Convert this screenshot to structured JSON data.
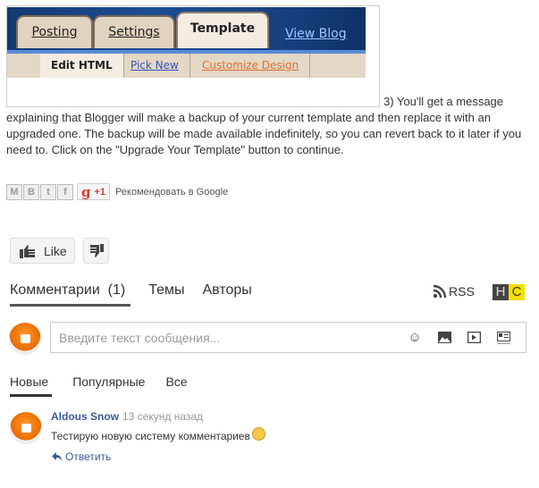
{
  "screenshot": {
    "tabs": [
      {
        "label": "Posting",
        "active": false
      },
      {
        "label": "Settings",
        "active": false
      },
      {
        "label": "Template",
        "active": true
      }
    ],
    "view_blog_link": "View Blog",
    "subtabs": [
      {
        "label": "Edit HTML",
        "style": "active"
      },
      {
        "label": "Pick New",
        "style": "blue"
      },
      {
        "label": "Customize Design",
        "style": "orange"
      }
    ]
  },
  "article": {
    "paragraph_first": "3) You'll get a message",
    "paragraph_rest": "explaining that Blogger will make a backup of your current template and then replace it with an upgraded one. The backup will be made available indefinitely, so you can revert back to it later if you need to. Click on the \"Upgrade Your Template\" button to continue."
  },
  "share": {
    "buttons": [
      "email-icon",
      "blogger-icon",
      "twitter-icon",
      "facebook-icon"
    ],
    "gplus_label": "+1",
    "recommend_text": "Рекомендовать в Google"
  },
  "reactions": {
    "like_label": "Like"
  },
  "comments": {
    "tabs": [
      {
        "label": "Комментарии  (1)",
        "active": true
      },
      {
        "label": "Темы",
        "active": false
      },
      {
        "label": "Авторы",
        "active": false
      }
    ],
    "rss_label": "RSS",
    "hc_h": "H",
    "hc_c": "C",
    "input_placeholder": "Введите текст сообщения...",
    "sort_tabs": [
      {
        "label": "Новые",
        "active": true
      },
      {
        "label": "Популярные",
        "active": false
      },
      {
        "label": "Все",
        "active": false
      }
    ],
    "items": [
      {
        "author": "Aldous Snow",
        "time": "13 секунд назад",
        "text": "Тестирую новую систему комментариев",
        "reply_label": "Ответить"
      }
    ]
  },
  "colors": {
    "link_blue": "#3b5998",
    "hc_yellow": "#f5e000",
    "blogger_orange": "#e96b00"
  }
}
